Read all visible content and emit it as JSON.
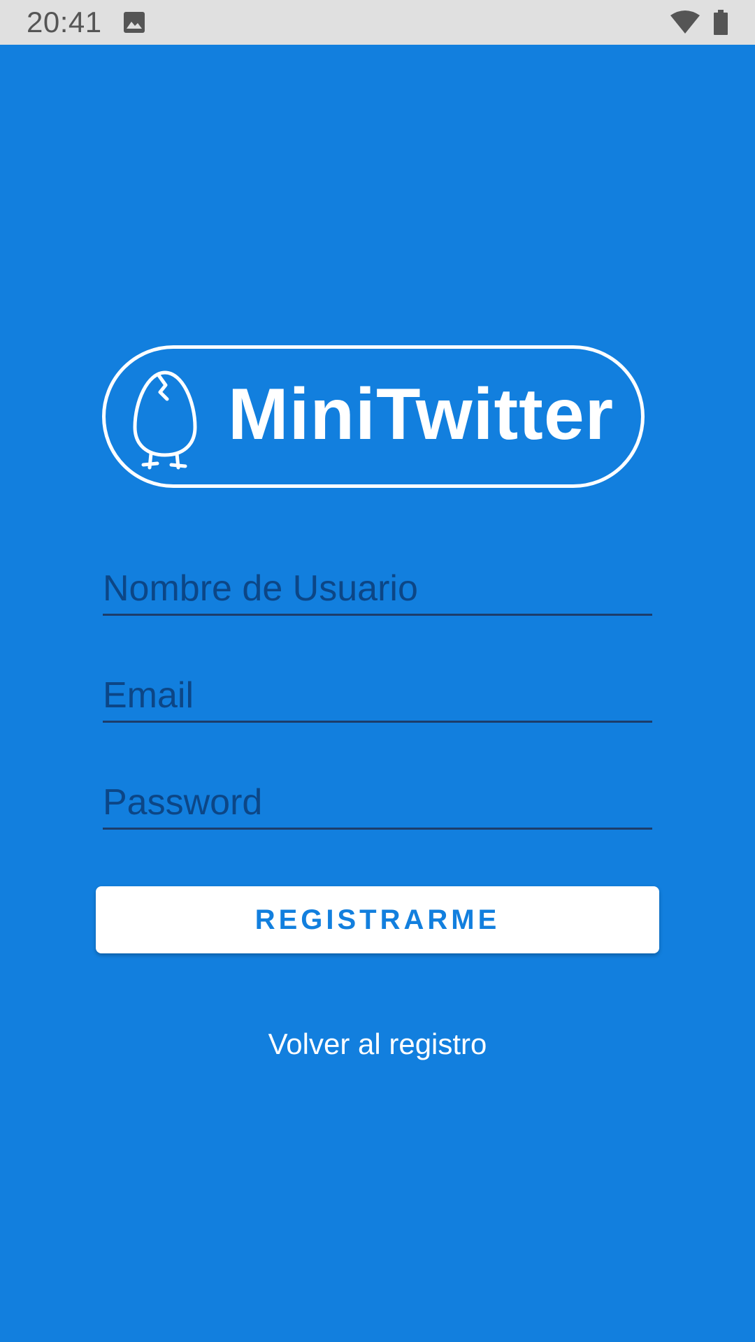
{
  "status_bar": {
    "time": "20:41",
    "icons": [
      "gallery-icon",
      "wifi-icon",
      "battery-icon"
    ]
  },
  "logo": {
    "text": "MiniTwitter",
    "icon": "egg-icon"
  },
  "form": {
    "username": {
      "value": "",
      "placeholder": "Nombre de Usuario"
    },
    "email": {
      "value": "",
      "placeholder": "Email"
    },
    "password": {
      "value": "",
      "placeholder": "Password"
    }
  },
  "register_button": {
    "label": "REGISTRARME"
  },
  "back_link": {
    "label": "Volver al registro"
  },
  "colors": {
    "background": "#127FDE",
    "status_bar": "#E0E0E0",
    "button_text": "#127FDE",
    "field_underline": "#1C3D6B"
  }
}
